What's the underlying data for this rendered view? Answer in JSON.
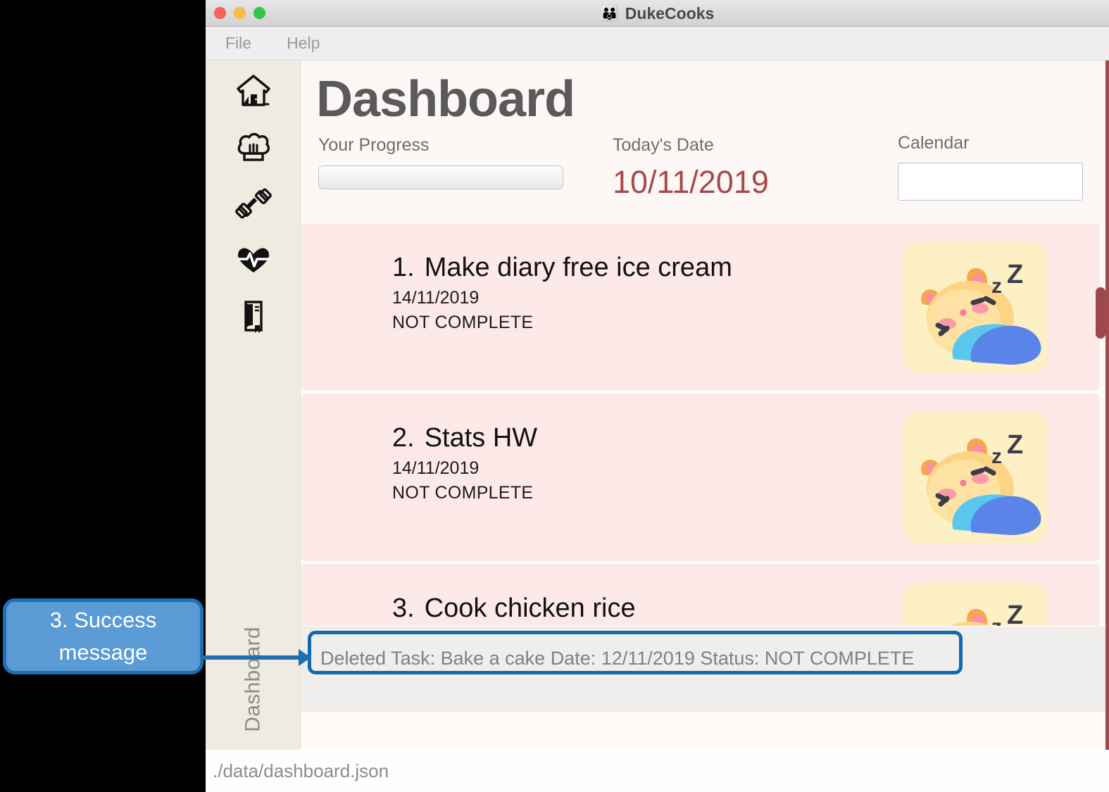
{
  "window": {
    "title": "DukeCooks",
    "title_icon": "chef-emoji",
    "traffic_lights": [
      "close",
      "minimize",
      "maximize"
    ]
  },
  "menu": {
    "items": [
      {
        "label": "File",
        "name": "menu-file"
      },
      {
        "label": "Help",
        "name": "menu-help"
      }
    ]
  },
  "sidebar": {
    "icons": [
      {
        "name": "home-icon",
        "label": "Home"
      },
      {
        "name": "chef-hat-icon",
        "label": "Recipes"
      },
      {
        "name": "dumbbell-icon",
        "label": "Workout"
      },
      {
        "name": "heart-pulse-icon",
        "label": "Health"
      },
      {
        "name": "diary-book-icon",
        "label": "Diary"
      }
    ],
    "tab_label": "Dashboard"
  },
  "header": {
    "page_title": "Dashboard",
    "progress_label": "Your Progress",
    "progress_percent": 0,
    "date_label": "Today's Date",
    "date_value": "10/11/2019",
    "calendar_label": "Calendar",
    "calendar_value": "",
    "calendar_placeholder": "",
    "calendar_button_icon": "calendar-grid-icon"
  },
  "tasks": [
    {
      "index": "1.",
      "title": "Make diary free ice cream",
      "date": "14/11/2019",
      "status": "NOT COMPLETE",
      "thumbnail": "sleeping-cat-icon"
    },
    {
      "index": "2.",
      "title": "Stats HW",
      "date": "14/11/2019",
      "status": "NOT COMPLETE",
      "thumbnail": "sleeping-cat-icon"
    },
    {
      "index": "3.",
      "title": "Cook chicken rice",
      "date": "",
      "status": "",
      "thumbnail": "sleeping-cat-icon"
    }
  ],
  "result": {
    "message": "Deleted Task: Bake a cake Date: 12/11/2019 Status: NOT COMPLETE"
  },
  "status_bar": {
    "path": "./data/dashboard.json"
  },
  "annotation": {
    "callout_text": "3. Success message",
    "callout_fill": "#5b9bd5",
    "callout_border": "#1f6fb2",
    "highlight_border": "#1268b3"
  },
  "colors": {
    "card_pink": "#fdeae8",
    "thumb_yellow": "#fdf0c4",
    "date_red": "#a44a4a",
    "scrollbar_maroon": "#9a4a4d",
    "sidebar_beige": "#efebe0"
  }
}
